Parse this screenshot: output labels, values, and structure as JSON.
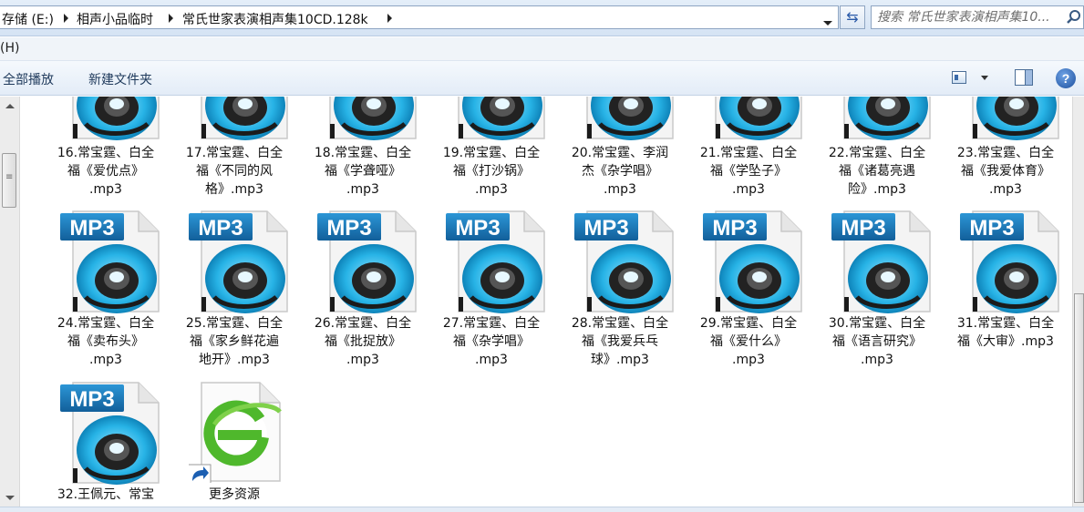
{
  "address": {
    "crumbs": [
      "存储 (E:)",
      "相声小品临时",
      "常氏世家表演相声集10CD.128k"
    ],
    "search_placeholder": "搜索 常氏世家表演相声集10..."
  },
  "menu": {
    "help_fragment": "(H)"
  },
  "toolbar": {
    "play_all": "全部播放",
    "new_folder": "新建文件夹",
    "help_glyph": "?"
  },
  "icon_badge_text": "MP3",
  "files_row1": [
    {
      "line1": "16.常宝霆、白全",
      "line2": "福《爱优点》",
      "line3": ".mp3"
    },
    {
      "line1": "17.常宝霆、白全",
      "line2": "福《不同的风",
      "line3": "格》.mp3"
    },
    {
      "line1": "18.常宝霆、白全",
      "line2": "福《学聋哑》",
      "line3": ".mp3"
    },
    {
      "line1": "19.常宝霆、白全",
      "line2": "福《打沙锅》",
      "line3": ".mp3"
    },
    {
      "line1": "20.常宝霆、李润",
      "line2": "杰《杂学唱》",
      "line3": ".mp3"
    },
    {
      "line1": "21.常宝霆、白全",
      "line2": "福《学坠子》",
      "line3": ".mp3"
    },
    {
      "line1": "22.常宝霆、白全",
      "line2": "福《诸葛亮遇",
      "line3": "险》.mp3"
    },
    {
      "line1": "23.常宝霆、白全",
      "line2": "福《我爱体育》",
      "line3": ".mp3"
    }
  ],
  "files_row2": [
    {
      "line1": "24.常宝霆、白全",
      "line2": "福《卖布头》",
      "line3": ".mp3"
    },
    {
      "line1": "25.常宝霆、白全",
      "line2": "福《家乡鲜花遍",
      "line3": "地开》.mp3"
    },
    {
      "line1": "26.常宝霆、白全",
      "line2": "福《批捉放》",
      "line3": ".mp3"
    },
    {
      "line1": "27.常宝霆、白全",
      "line2": "福《杂学唱》",
      "line3": ".mp3"
    },
    {
      "line1": "28.常宝霆、白全",
      "line2": "福《我爱兵乓",
      "line3": "球》.mp3"
    },
    {
      "line1": "29.常宝霆、白全",
      "line2": "福《爱什么》",
      "line3": ".mp3"
    },
    {
      "line1": "30.常宝霆、白全",
      "line2": "福《语言研究》",
      "line3": ".mp3"
    },
    {
      "line1": "31.常宝霆、白全",
      "line2": "福《大审》.mp3",
      "line3": ""
    }
  ],
  "files_row3": [
    {
      "line1": "32.王佩元、常宝",
      "line2": "",
      "line3": ""
    },
    {
      "line1": "更多资源",
      "line2": "",
      "line3": ""
    }
  ],
  "colors": {
    "badge_blue": "#1f7fc0",
    "disc_cyan": "#27b3e6",
    "ie_green": "#4fb82c"
  }
}
